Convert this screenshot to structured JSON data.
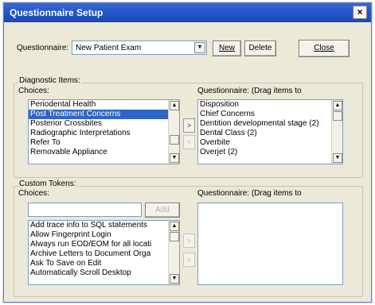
{
  "window": {
    "title": "Questionnaire Setup",
    "close_glyph": "×"
  },
  "questionnaire": {
    "label": "Questionnaire:",
    "value": "New Patient Exam",
    "new_label": "New",
    "delete_label": "Delete"
  },
  "close_label": "Close",
  "diagnostic": {
    "group_label": "Diagnostic Items:",
    "choices_label": "Choices:",
    "right_label": "Questionnaire:  (Drag items to",
    "choices": [
      "Periodental Health",
      "Post Treatment Concerns",
      "Posterior Crossbites",
      "Radiographic Interpretations",
      "Refer To",
      "Removable Appliance"
    ],
    "selected_index": 1,
    "questionnaire_items": [
      "Disposition",
      "Chief Concerns",
      "Dentition developmental stage (2)",
      "Dental Class (2)",
      "Overbite",
      "Overjet (2)"
    ]
  },
  "custom": {
    "group_label": "Custom Tokens:",
    "choices_label": "Choices:",
    "right_label": "Questionnaire:  (Drag items to",
    "add_label": "Add",
    "search_value": "",
    "choices": [
      "Add trace info to SQL statements",
      "Allow Fingerprint Login",
      "Always run EOD/EOM for all locati",
      "Archive Letters to Document Orga",
      "Ask To Save on Edit",
      "Automatically Scroll Desktop"
    ]
  },
  "icons": {
    "up": "▲",
    "down": "▼",
    "move_right": ">",
    "move_left": "<"
  }
}
